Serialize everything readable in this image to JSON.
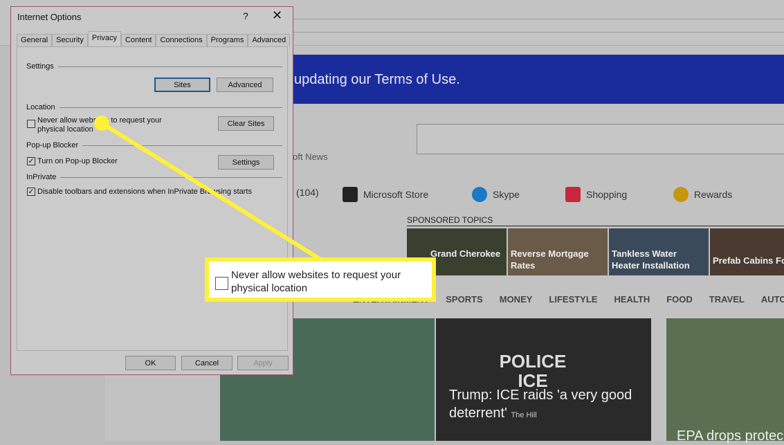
{
  "browser": {
    "banner_text": "updating our Terms of Use.",
    "msn_news_partial": "oft News",
    "nav_items": [
      {
        "label": "(104)",
        "icon": "mail-count"
      },
      {
        "label": "Microsoft Store",
        "icon": "store-bag-icon"
      },
      {
        "label": "Skype",
        "icon": "skype-icon"
      },
      {
        "label": "Shopping",
        "icon": "shopping-bag-icon"
      },
      {
        "label": "Rewards",
        "icon": "medal-icon"
      }
    ],
    "sponsored_title": "SPONSORED TOPICS",
    "sponsored_tiles": [
      "Grand Cherokee",
      "Reverse Mortgage Rates",
      "Tankless Water Heater Installation",
      "Prefab Cabins Fo"
    ],
    "categories": [
      "ENTERTAINMENT",
      "SPORTS",
      "MONEY",
      "LIFESTYLE",
      "HEALTH",
      "FOOD",
      "TRAVEL",
      "AUTO"
    ],
    "news": [
      {
        "headline": "Trump: ICE raids 'a very good deterrent'",
        "source": "The Hill",
        "image_text": "POLICE ICE"
      },
      {
        "headline": "EPA drops protec"
      }
    ],
    "colors": {
      "banner": "#1a2c9c",
      "highlight": "#fff03a"
    }
  },
  "dialog": {
    "title": "Internet Options",
    "help": "?",
    "close": "✕",
    "tabs": [
      "General",
      "Security",
      "Privacy",
      "Content",
      "Connections",
      "Programs",
      "Advanced"
    ],
    "active_tab": "Privacy",
    "settings": {
      "label": "Settings",
      "sites": "Sites",
      "advanced": "Advanced"
    },
    "location": {
      "label": "Location",
      "checkbox": "Never allow websites to request your physical location",
      "checked": false,
      "clear_sites": "Clear Sites"
    },
    "popup": {
      "label": "Pop-up Blocker",
      "checkbox": "Turn on Pop-up Blocker",
      "checked": true,
      "settings": "Settings"
    },
    "inprivate": {
      "label": "InPrivate",
      "checkbox": "Disable toolbars and extensions when InPrivate Browsing starts",
      "checked": true
    },
    "ok": "OK",
    "cancel": "Cancel",
    "apply": "Apply"
  },
  "callout": {
    "text": "Never allow websites to request your physical location",
    "checked": false
  }
}
